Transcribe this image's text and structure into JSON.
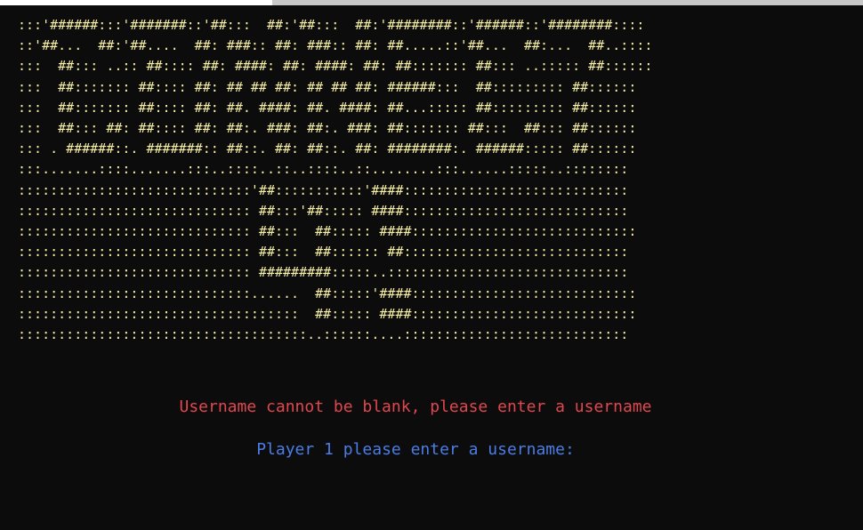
{
  "terminal": {
    "ascii_art": [
      ":::'######:::'#######::'##:::  ##:'##:::  ##:'########::'######::'########::::",
      "::'##...  ##:'##....  ##: ###:: ##: ###:: ##: ##.....::'##...  ##:...  ##..::::",
      ":::  ##::: ..:: ##:::: ##: ####: ##: ####: ##: ##::::::: ##::: ..::::: ##::::::",
      ":::  ##::::::: ##:::: ##: ## ## ##: ## ## ##: ######:::  ##::::::::: ##::::::",
      ":::  ##::::::: ##:::: ##: ##. ####: ##. ####: ##...::::: ##::::::::: ##::::::",
      ":::  ##::: ##: ##:::: ##: ##:. ###: ##:. ###: ##::::::: ##:::  ##::: ##::::::",
      "::: . ######::. #######:: ##::. ##: ##::. ##: ########:. ######::::: ##::::::",
      ":::.......::::.......:::..::::..::..::::..::........:::......:::::..::::::::",
      ":::::::::::::::::::::::::::::'##:::::::::::'####::::::::::::::::::::::::::::",
      "::::::::::::::::::::::::::::: ##:::'##::::: ####::::::::::::::::::::::::::::",
      "::::::::::::::::::::::::::::: ##:::  ##::::: ####::::::::::::::::::::::::::::",
      "::::::::::::::::::::::::::::: ##:::  ##:::::: ##::::::::::::::::::::::::::::",
      "::::::::::::::::::::::::::::: #########:::::..::::::::::::::::::::::::::::::",
      ":::::::::::::::::::::::::::::......  ##:::::'####::::::::::::::::::::::::::::",
      ":::::::::::::::::::::::::::::::::::  ##::::: ####::::::::::::::::::::::::::::",
      "::::::::::::::::::::::::::::::::::::..::::::....::::::::::::::::::::::::::::"
    ],
    "error_message": "Username cannot be blank, please enter a username",
    "prompt_message": "Player 1 please enter a username:",
    "colors": {
      "background": "#0c0c0c",
      "ascii": "#f7f0a6",
      "error": "#e0474f",
      "prompt": "#4b7de6"
    }
  }
}
